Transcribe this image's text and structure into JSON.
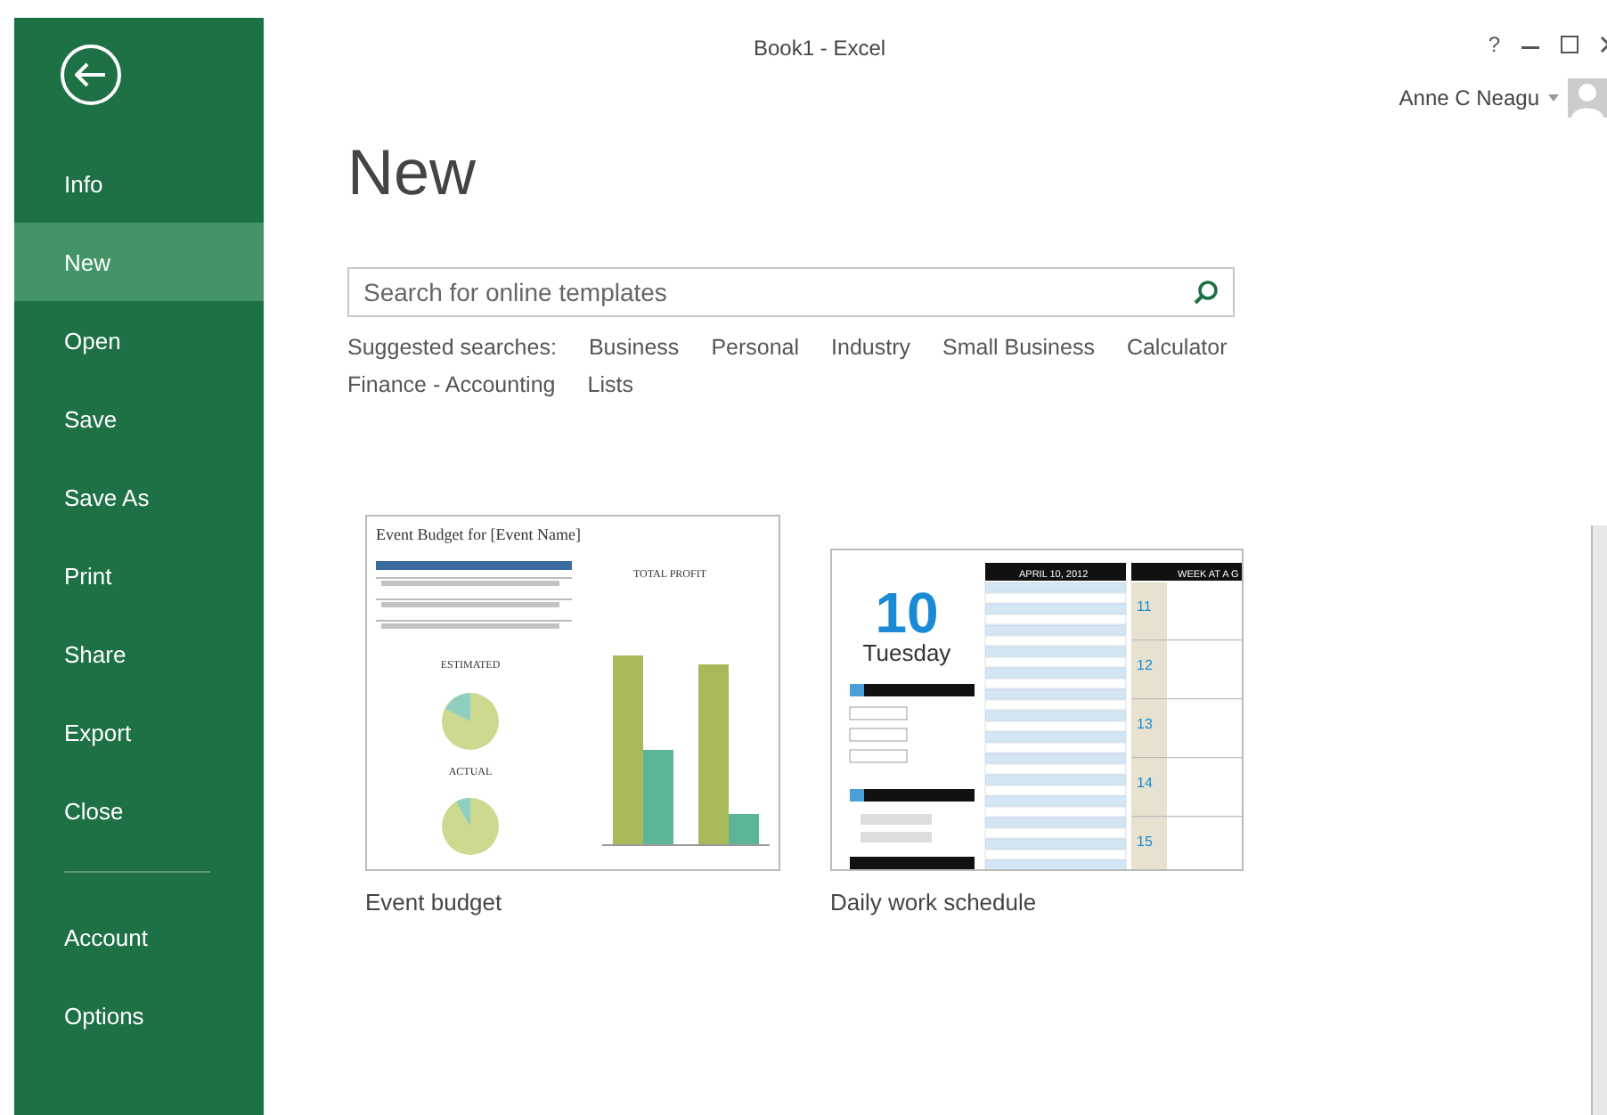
{
  "window": {
    "title": "Book1 - Excel",
    "help": "?"
  },
  "user": {
    "name": "Anne C Neagu"
  },
  "sidebar": {
    "items": [
      {
        "label": "Info",
        "selected": false
      },
      {
        "label": "New",
        "selected": true
      },
      {
        "label": "Open",
        "selected": false
      },
      {
        "label": "Save",
        "selected": false
      },
      {
        "label": "Save As",
        "selected": false
      },
      {
        "label": "Print",
        "selected": false
      },
      {
        "label": "Share",
        "selected": false
      },
      {
        "label": "Export",
        "selected": false
      },
      {
        "label": "Close",
        "selected": false
      }
    ],
    "bottom_items": [
      {
        "label": "Account",
        "selected": false
      },
      {
        "label": "Options",
        "selected": false
      }
    ]
  },
  "heading": "New",
  "search": {
    "placeholder": "Search for online templates"
  },
  "suggested": {
    "label": "Suggested searches:",
    "items": [
      "Business",
      "Personal",
      "Industry",
      "Small Business",
      "Calculator",
      "Finance - Accounting",
      "Lists"
    ]
  },
  "templates": [
    {
      "kind": "budget",
      "name": "Event budget",
      "title": "Event Budget for [Event Name]",
      "chart_title": "TOTAL PROFIT",
      "pie_titles": [
        "ESTIMATED",
        "ACTUAL"
      ]
    },
    {
      "kind": "schedule",
      "name": "Daily work schedule",
      "day_number": "10",
      "weekday": "Tuesday",
      "date_header": "APRIL 10, 2012",
      "week_header": "WEEK AT A G",
      "week_days": [
        "11",
        "12",
        "13",
        "14",
        "15"
      ]
    }
  ]
}
